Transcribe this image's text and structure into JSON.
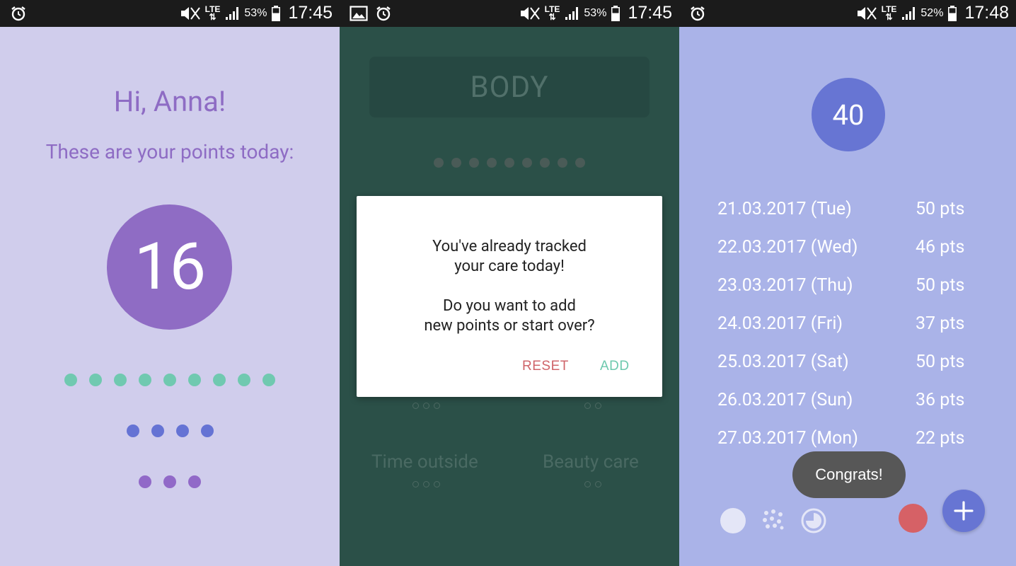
{
  "status_bars": [
    {
      "battery": "53%",
      "time": "17:45",
      "network": "LTE"
    },
    {
      "battery": "53%",
      "time": "17:45",
      "network": "LTE"
    },
    {
      "battery": "52%",
      "time": "17:48",
      "network": "LTE"
    }
  ],
  "screen1": {
    "greeting": "Hi, Anna!",
    "subtitle": "These are your points today:",
    "points": "16",
    "dot_rows": [
      {
        "count": 9,
        "color": "#70c9b0"
      },
      {
        "count": 4,
        "color": "#6573d4"
      },
      {
        "count": 3,
        "color": "#9169c8"
      }
    ],
    "colors": {
      "background": "#d0cdec",
      "accent": "#8f6cc4"
    }
  },
  "screen2": {
    "banner": "BODY",
    "categories": [
      "Time outside",
      "Beauty care"
    ],
    "dialog": {
      "message": "You've already tracked\nyour care today!\n\nDo you want to add\nnew points or start over?",
      "reset_label": "RESET",
      "add_label": "ADD"
    },
    "colors": {
      "background": "#2b5048",
      "reset": "#cf6469",
      "add": "#6ec9ae"
    }
  },
  "screen3": {
    "total": "40",
    "log": [
      {
        "date": "21.03.2017 (Tue)",
        "points": "50 pts"
      },
      {
        "date": "22.03.2017 (Wed)",
        "points": "46 pts"
      },
      {
        "date": "23.03.2017 (Thu)",
        "points": "50 pts"
      },
      {
        "date": "24.03.2017 (Fri)",
        "points": "37 pts"
      },
      {
        "date": "25.03.2017 (Sat)",
        "points": "50 pts"
      },
      {
        "date": "26.03.2017 (Sun)",
        "points": "36 pts"
      },
      {
        "date": "27.03.2017 (Mon)",
        "points": "22 pts"
      }
    ],
    "toast": "Congrats!",
    "fab_icon": "plus-icon",
    "colors": {
      "background": "#aab3e8",
      "accent": "#6775d3",
      "danger": "#d66166"
    }
  }
}
